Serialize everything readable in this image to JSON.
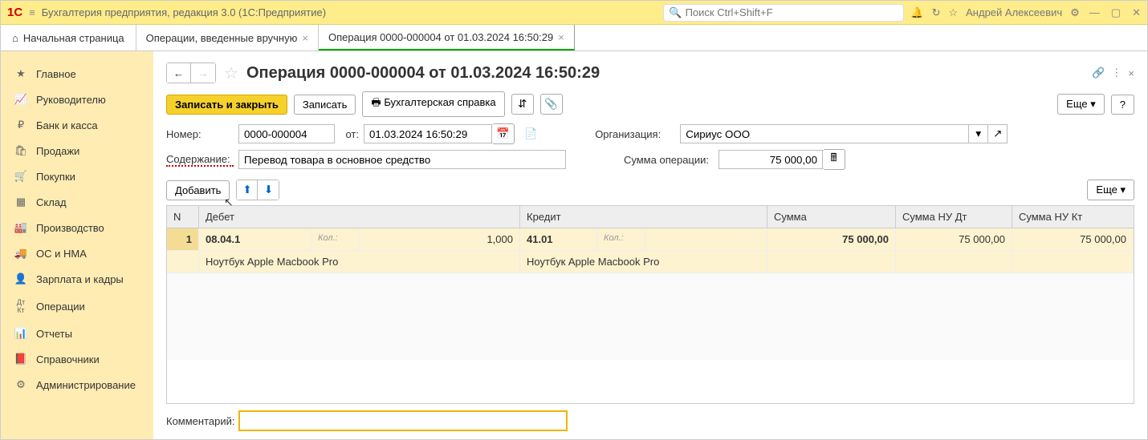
{
  "title": "Бухгалтерия предприятия, редакция 3.0  (1С:Предприятие)",
  "search_placeholder": "Поиск Ctrl+Shift+F",
  "user": "Андрей Алексеевич",
  "tabs": {
    "home": "Начальная страница",
    "t1": "Операции, введенные вручную",
    "t2": "Операция 0000-000004 от 01.03.2024 16:50:29"
  },
  "sidebar": {
    "items": [
      "Главное",
      "Руководителю",
      "Банк и касса",
      "Продажи",
      "Покупки",
      "Склад",
      "Производство",
      "ОС и НМА",
      "Зарплата и кадры",
      "Операции",
      "Отчеты",
      "Справочники",
      "Администрирование"
    ]
  },
  "doc": {
    "title": "Операция 0000-000004 от 01.03.2024 16:50:29",
    "save_close": "Записать и закрыть",
    "save": "Записать",
    "accounting_ref": "Бухгалтерская справка",
    "more": "Еще",
    "number_lbl": "Номер:",
    "number": "0000-000004",
    "from_lbl": "от:",
    "date": "01.03.2024 16:50:29",
    "org_lbl": "Организация:",
    "org": "Сириус ООО",
    "content_lbl": "Содержание:",
    "content": "Перевод товара в основное средство",
    "sum_lbl": "Сумма операции:",
    "sum": "75 000,00",
    "add": "Добавить",
    "headers": {
      "n": "N",
      "debit": "Дебет",
      "credit": "Кредит",
      "sum": "Сумма",
      "nu_dt": "Сумма НУ Дт",
      "nu_kt": "Сумма НУ Кт"
    },
    "row": {
      "n": "1",
      "dacc": "08.04.1",
      "qty_lbl": "Кол.:",
      "qty": "1,000",
      "cacc": "41.01",
      "sum": "75 000,00",
      "nu_dt": "75 000,00",
      "nu_kt": "75 000,00",
      "ditem": "Ноутбук Apple Macbook Pro",
      "citem": "Ноутбук Apple Macbook Pro"
    },
    "comment_lbl": "Комментарий:"
  }
}
